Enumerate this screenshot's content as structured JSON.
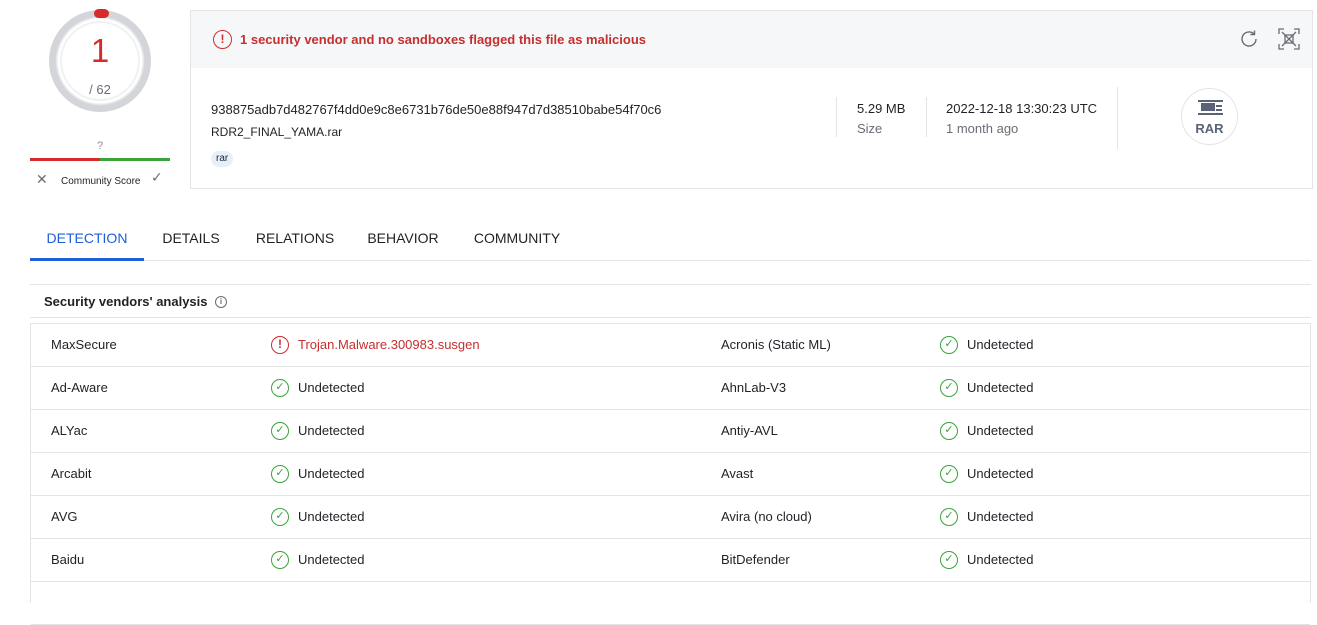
{
  "score": {
    "detections": "1",
    "total": "/ 62",
    "community_unknown": "?",
    "community_label": "Community Score",
    "community_dislike_icon": "close-icon",
    "community_like_icon": "check-icon"
  },
  "alert": {
    "icon": "exclamation-circle-icon",
    "text": "1 security vendor and no sandboxes flagged this file as malicious"
  },
  "actions": {
    "reload_icon": "reload-icon",
    "expand_icon": "expand-icon"
  },
  "file": {
    "hash": "938875adb7d482767f4dd0e9c8e6731b76de50e88f947d7d38510babe54f70c6",
    "name": "RDR2_FINAL_YAMA.rar",
    "tag": "rar",
    "size_value": "5.29 MB",
    "size_label": "Size",
    "date_value": "2022-12-18 13:30:23 UTC",
    "date_relative": "1 month ago",
    "type_label": "RAR"
  },
  "tabs": [
    {
      "label": "DETECTION",
      "active": true
    },
    {
      "label": "DETAILS",
      "active": false
    },
    {
      "label": "RELATIONS",
      "active": false
    },
    {
      "label": "BEHAVIOR",
      "active": false
    },
    {
      "label": "COMMUNITY",
      "active": false
    }
  ],
  "vendors": {
    "title": "Security vendors' analysis",
    "info_icon": "info-icon",
    "rows": [
      {
        "left_name": "MaxSecure",
        "left_result": "Trojan.Malware.300983.susgen",
        "left_status": "malicious",
        "right_name": "Acronis (Static ML)",
        "right_result": "Undetected",
        "right_status": "clean"
      },
      {
        "left_name": "Ad-Aware",
        "left_result": "Undetected",
        "left_status": "clean",
        "right_name": "AhnLab-V3",
        "right_result": "Undetected",
        "right_status": "clean"
      },
      {
        "left_name": "ALYac",
        "left_result": "Undetected",
        "left_status": "clean",
        "right_name": "Antiy-AVL",
        "right_result": "Undetected",
        "right_status": "clean"
      },
      {
        "left_name": "Arcabit",
        "left_result": "Undetected",
        "left_status": "clean",
        "right_name": "Avast",
        "right_result": "Undetected",
        "right_status": "clean"
      },
      {
        "left_name": "AVG",
        "left_result": "Undetected",
        "left_status": "clean",
        "right_name": "Avira (no cloud)",
        "right_result": "Undetected",
        "right_status": "clean"
      },
      {
        "left_name": "Baidu",
        "left_result": "Undetected",
        "left_status": "clean",
        "right_name": "BitDefender",
        "right_result": "Undetected",
        "right_status": "clean"
      },
      {
        "left_name": "",
        "left_result": "",
        "left_status": "",
        "right_name": "",
        "right_result": "",
        "right_status": ""
      }
    ]
  },
  "colors": {
    "malicious": "#d52b2b",
    "clean": "#3aa33a",
    "accent": "#1e5fd6",
    "border": "#e3e4e8"
  }
}
